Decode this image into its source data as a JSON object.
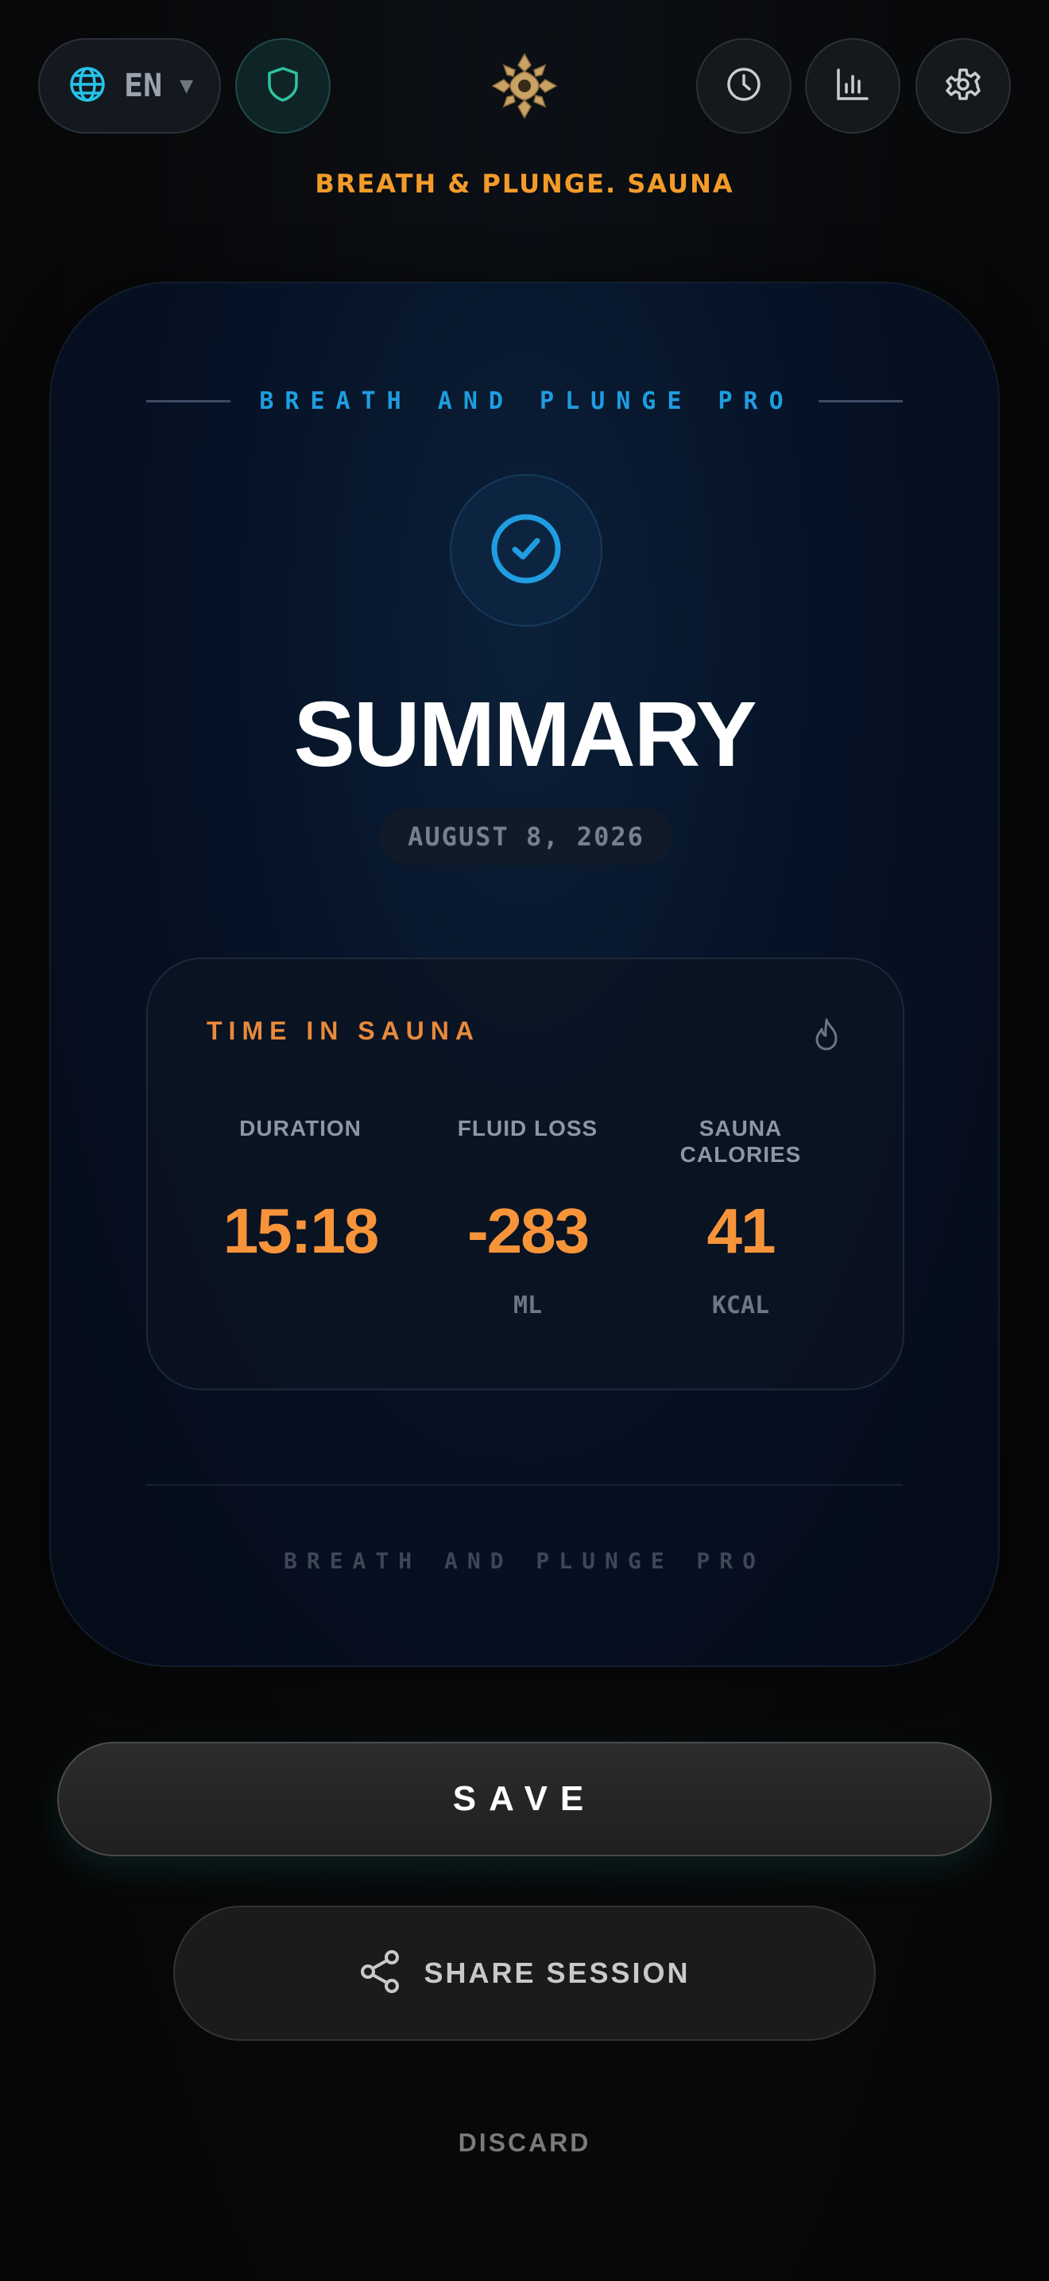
{
  "header": {
    "language": "EN",
    "app_subtitle": "BREATH & PLUNGE. SAUNA",
    "icons": {
      "language": "globe-icon",
      "shield": "shield-icon",
      "history": "clock-icon",
      "stats": "bar-chart-icon",
      "settings": "gear-icon",
      "logo": "ornament-logo"
    }
  },
  "card": {
    "brand": "BREATH AND PLUNGE PRO",
    "title": "SUMMARY",
    "date": "AUGUST 8, 2026",
    "section_title": "TIME IN SAUNA",
    "stats": {
      "duration": {
        "label": "DURATION",
        "value": "15:18",
        "unit": ""
      },
      "fluid_loss": {
        "label": "FLUID LOSS",
        "value": "-283",
        "unit": "ML"
      },
      "calories": {
        "label": "SAUNA CALORIES",
        "value": "41",
        "unit": "KCAL"
      }
    },
    "footer_brand": "BREATH AND PLUNGE PRO"
  },
  "actions": {
    "save_label": "SAVE",
    "share_label": "SHARE SESSION",
    "discard_label": "DISCARD"
  },
  "colors": {
    "accent_orange": "#f39b2a",
    "accent_blue": "#1f9de0",
    "shield_green": "#2ec4a0"
  }
}
